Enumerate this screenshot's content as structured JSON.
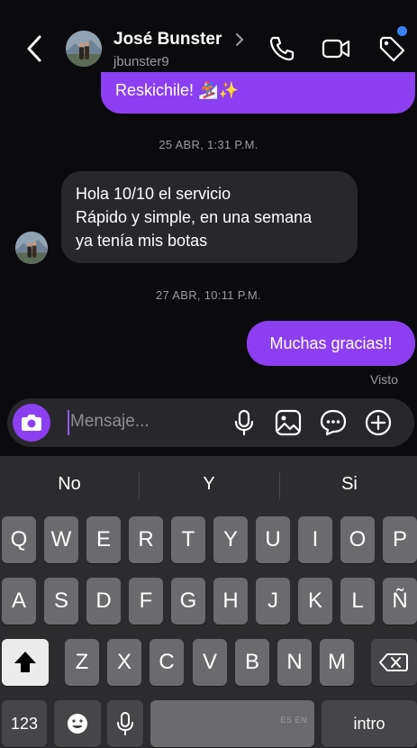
{
  "header": {
    "contact_name": "José Bunster",
    "username": "jbunster9",
    "icons": [
      "back-chevron-icon",
      "phone-icon",
      "video-camera-icon",
      "tag-icon"
    ]
  },
  "messages": {
    "outgoing_partial": "Reskichile! 🏂✨",
    "timestamp_1": "25 ABR, 1:31 P.M.",
    "incoming_lines": [
      "Hola 10/10 el servicio",
      "Rápido y simple, en una semana",
      "ya tenía mis botas"
    ],
    "timestamp_2": "27 ABR, 10:11 P.M.",
    "outgoing": "Muchas gracias!!",
    "status": "Visto"
  },
  "composer": {
    "placeholder": "Mensaje...",
    "icons": [
      "camera-icon",
      "microphone-icon",
      "gallery-icon",
      "sticker-icon",
      "plus-circle-icon"
    ]
  },
  "keyboard": {
    "suggestions": [
      "No",
      "Y",
      "Si"
    ],
    "row1": [
      "Q",
      "W",
      "E",
      "R",
      "T",
      "Y",
      "U",
      "I",
      "O",
      "P"
    ],
    "row2": [
      "A",
      "S",
      "D",
      "F",
      "G",
      "H",
      "J",
      "K",
      "L",
      "Ñ"
    ],
    "row3": [
      "Z",
      "X",
      "C",
      "V",
      "B",
      "N",
      "M"
    ],
    "numbers_label": "123",
    "space_language": "ES EN",
    "return_label": "intro"
  }
}
